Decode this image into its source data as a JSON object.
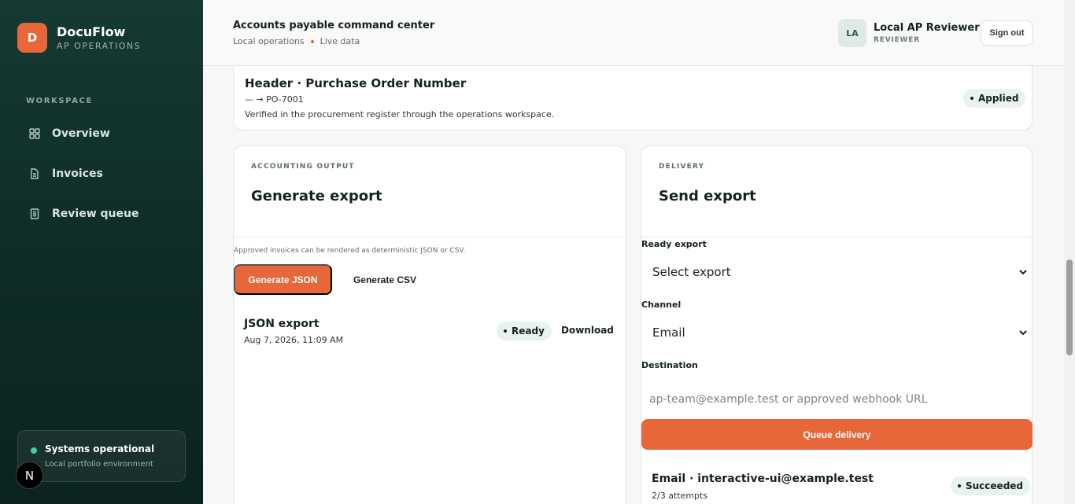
{
  "brand": {
    "logo_letter": "D",
    "name": "DocuFlow",
    "subtitle": "AP OPERATIONS"
  },
  "sidebar": {
    "section_label": "WORKSPACE",
    "items": [
      {
        "label": "Overview",
        "icon": "grid-icon"
      },
      {
        "label": "Invoices",
        "icon": "document-icon"
      },
      {
        "label": "Review queue",
        "icon": "list-document-icon"
      }
    ],
    "status": {
      "title": "Systems operational",
      "subtitle": "Local portfolio environment",
      "color": "#3fd19a"
    },
    "devtools_badge": "N"
  },
  "topbar": {
    "title": "Accounts payable command center",
    "subtitle_left": "Local operations",
    "subtitle_right": "Live data",
    "user_initials": "LA",
    "user_name": "Local AP Reviewer",
    "user_role": "REVIEWER",
    "signout_label": "Sign out"
  },
  "header_change": {
    "title": "Header · Purchase Order Number",
    "change": "— → PO-7001",
    "description": "Verified in the procurement register through the operations workspace.",
    "status": "Applied"
  },
  "accounting": {
    "eyebrow": "ACCOUNTING OUTPUT",
    "title": "Generate export",
    "note": "Approved invoices can be rendered as deterministic JSON or CSV.",
    "generate_json_label": "Generate JSON",
    "generate_csv_label": "Generate CSV",
    "export": {
      "title": "JSON export",
      "date": "Aug 7, 2026, 11:09 AM",
      "status": "Ready",
      "download_label": "Download"
    }
  },
  "delivery": {
    "eyebrow": "DELIVERY",
    "title": "Send export",
    "ready_export_label": "Ready export",
    "ready_export_value": "Select export",
    "channel_label": "Channel",
    "channel_value": "Email",
    "destination_label": "Destination",
    "destination_placeholder": "ap-team@example.test or approved webhook URL",
    "queue_label": "Queue delivery",
    "record": {
      "title": "Email · interactive-ui@example.test",
      "attempts": "2/3 attempts",
      "status": "Succeeded"
    }
  },
  "colors": {
    "accent": "#e8673a",
    "sidebar_bg": "#153a33",
    "pill_bg": "#e9f2ee"
  }
}
